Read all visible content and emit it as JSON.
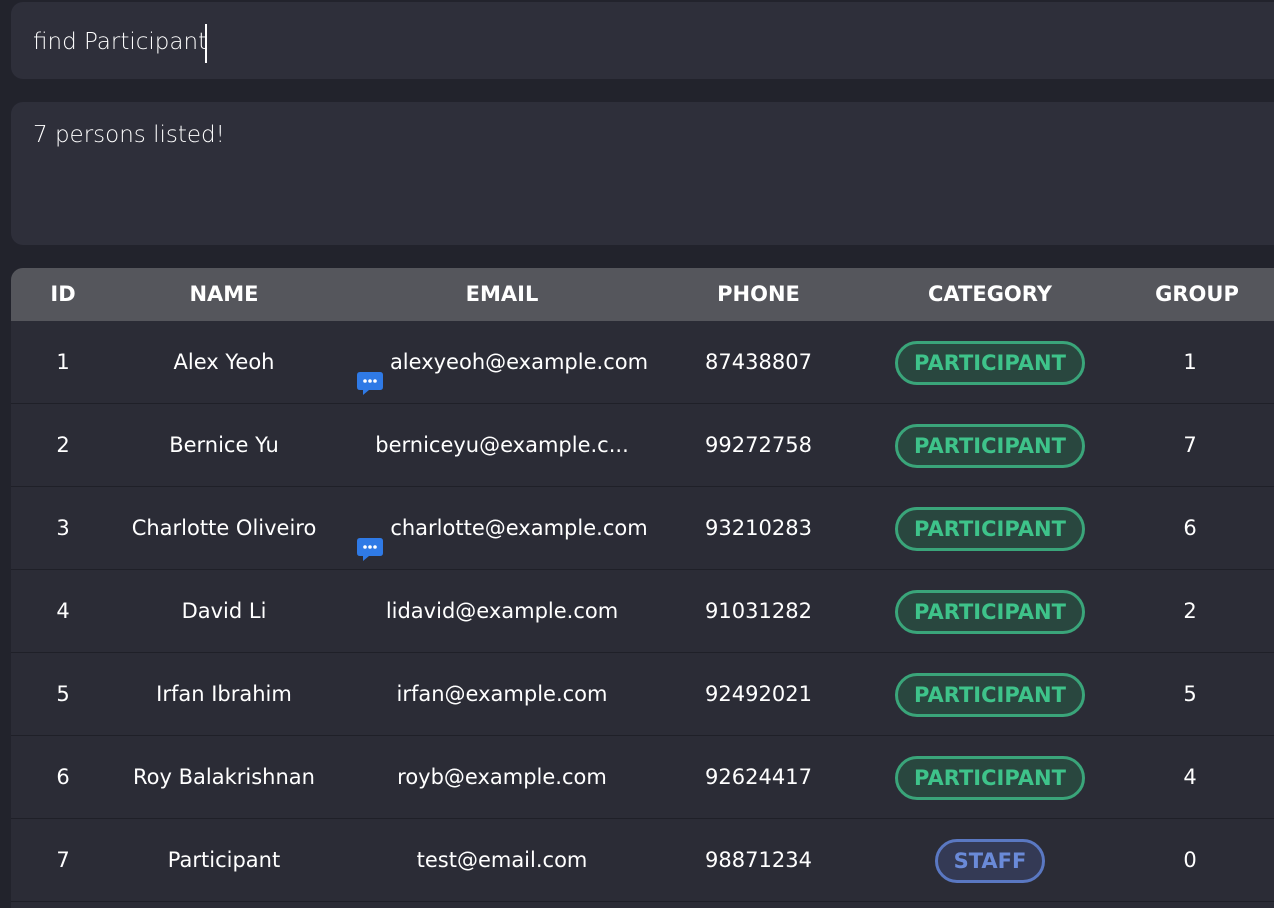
{
  "command": {
    "value": "find Participant"
  },
  "result": {
    "message": "7 persons listed!"
  },
  "table": {
    "headers": {
      "id": "ID",
      "name": "NAME",
      "email": "EMAIL",
      "phone": "PHONE",
      "category": "CATEGORY",
      "group": "GROUP"
    },
    "rows": [
      {
        "id": "1",
        "name": "Alex Yeoh",
        "email": "alexyeoh@example.com",
        "has_chat_icon": true,
        "phone": "87438807",
        "category": "PARTICIPANT",
        "group": "1"
      },
      {
        "id": "2",
        "name": "Bernice Yu",
        "email": "berniceyu@example.c...",
        "has_chat_icon": false,
        "phone": "99272758",
        "category": "PARTICIPANT",
        "group": "7"
      },
      {
        "id": "3",
        "name": "Charlotte Oliveiro",
        "email": "charlotte@example.com",
        "has_chat_icon": true,
        "phone": "93210283",
        "category": "PARTICIPANT",
        "group": "6"
      },
      {
        "id": "4",
        "name": "David Li",
        "email": "lidavid@example.com",
        "has_chat_icon": false,
        "phone": "91031282",
        "category": "PARTICIPANT",
        "group": "2"
      },
      {
        "id": "5",
        "name": "Irfan Ibrahim",
        "email": "irfan@example.com",
        "has_chat_icon": false,
        "phone": "92492021",
        "category": "PARTICIPANT",
        "group": "5"
      },
      {
        "id": "6",
        "name": "Roy Balakrishnan",
        "email": "royb@example.com",
        "has_chat_icon": false,
        "phone": "92624417",
        "category": "PARTICIPANT",
        "group": "4"
      },
      {
        "id": "7",
        "name": "Participant",
        "email": "test@email.com",
        "has_chat_icon": false,
        "phone": "98871234",
        "category": "STAFF",
        "group": "0"
      }
    ]
  },
  "icons": {
    "chat": "chat-bubble-icon"
  },
  "colors": {
    "background": "#22232c",
    "panel": "#2e2f3a",
    "header": "#55565c",
    "participant": "#3ec38a",
    "staff": "#6a8ad8",
    "chat_icon": "#2f7ae6"
  }
}
